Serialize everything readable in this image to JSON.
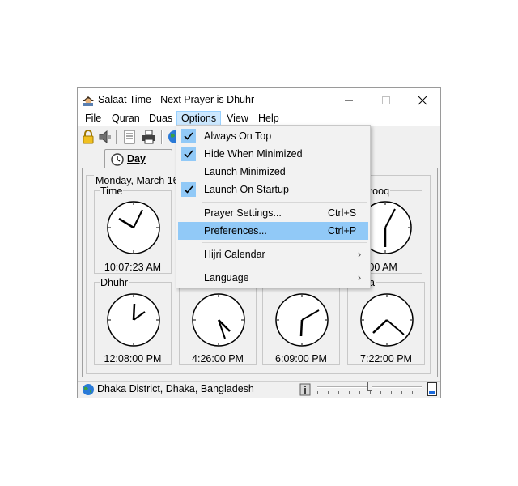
{
  "window": {
    "title": "Salaat Time - Next Prayer is Dhuhr",
    "controls": [
      "minimize-icon",
      "maximize-icon",
      "close-icon"
    ]
  },
  "menubar": {
    "items": [
      "File",
      "Quran",
      "Duas",
      "Options",
      "View",
      "Help"
    ],
    "active": "Options"
  },
  "toolbar": {
    "icons": [
      "lock-icon",
      "speaker-icon",
      "document-icon",
      "printer-icon",
      "globe-icon"
    ]
  },
  "tabs": [
    {
      "label": "Day",
      "icon": "clock-icon",
      "selected": true
    }
  ],
  "date_label": "Monday, March 16",
  "clocks": [
    {
      "label": "Time",
      "time": "10:07:23 AM"
    },
    {
      "label": "rooq",
      "time": "05:00 AM"
    },
    {
      "label": "Dhuhr",
      "time": "12:08:00 PM"
    },
    {
      "label": "",
      "time": "4:26:00 PM"
    },
    {
      "label": "",
      "time": "6:09:00 PM"
    },
    {
      "label": "a",
      "time": "7:22:00 PM"
    }
  ],
  "status": {
    "location": "Dhaka District, Dhaka, Bangladesh",
    "volume_level": 0.5
  },
  "options_menu": {
    "items": [
      {
        "label": "Always On Top",
        "checked": true
      },
      {
        "label": "Hide When Minimized",
        "checked": true
      },
      {
        "label": "Launch Minimized",
        "checked": false
      },
      {
        "label": "Launch On Startup",
        "checked": true
      },
      {
        "label": "Prayer Settings...",
        "shortcut": "Ctrl+S"
      },
      {
        "label": "Preferences...",
        "shortcut": "Ctrl+P",
        "highlighted": true
      },
      {
        "label": "Hijri Calendar",
        "submenu": true
      },
      {
        "label": "Language",
        "submenu": true
      }
    ]
  },
  "colors": {
    "menu_highlight": "#91c9f7",
    "menu_active": "#cce8ff",
    "window_bg": "#f0f0f0"
  }
}
